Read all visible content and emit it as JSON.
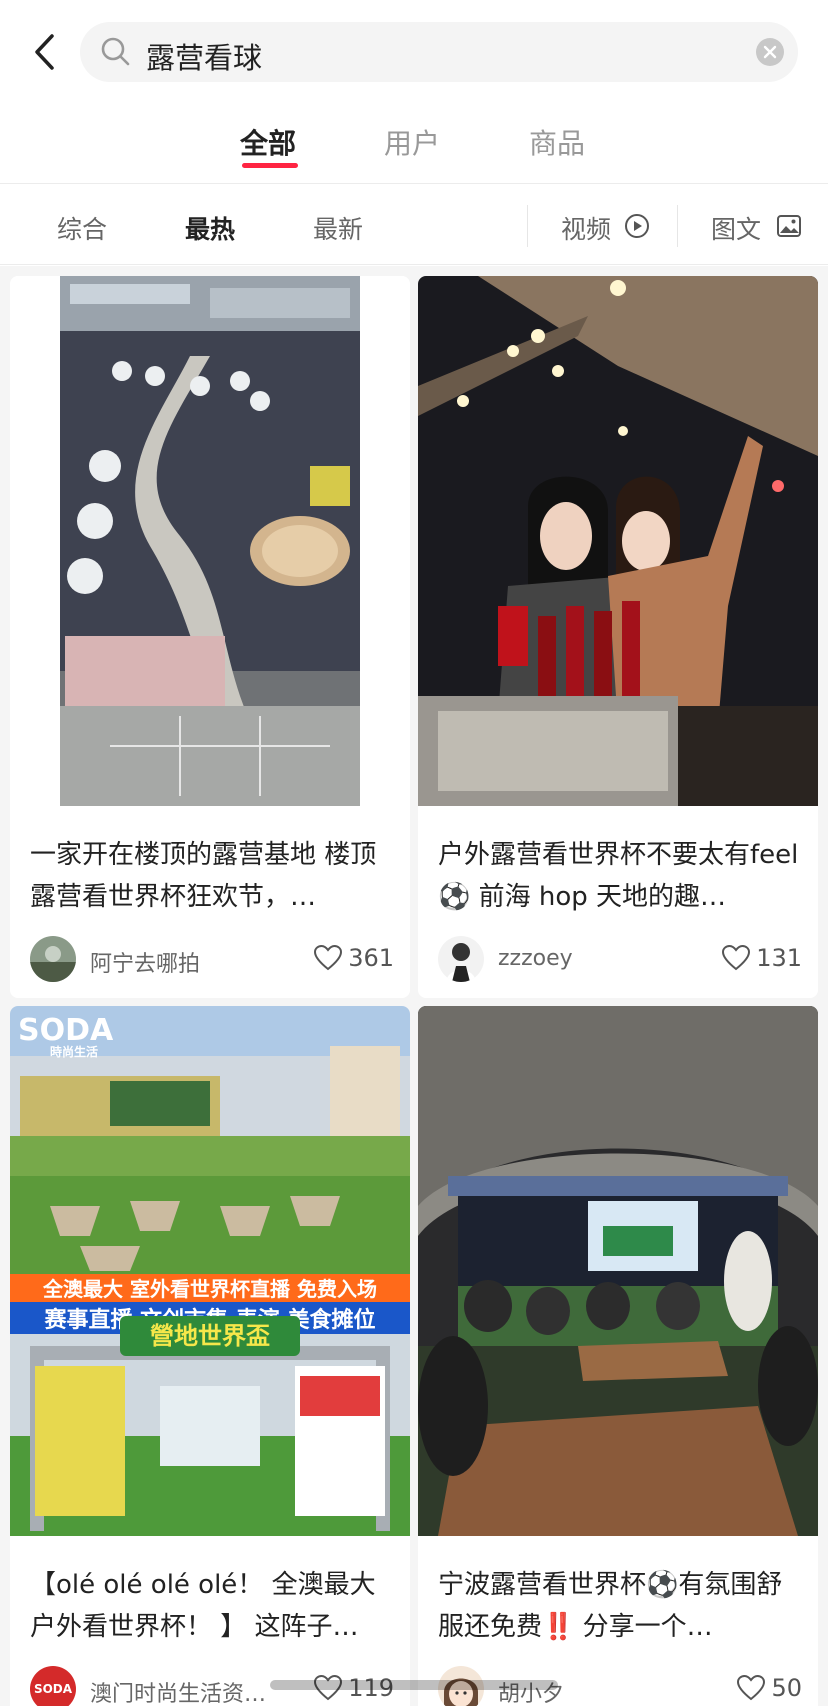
{
  "search": {
    "query": "露营看球"
  },
  "tabs": [
    {
      "label": "全部",
      "active": true
    },
    {
      "label": "用户",
      "active": false
    },
    {
      "label": "商品",
      "active": false
    }
  ],
  "filters": {
    "sort": [
      {
        "label": "综合",
        "active": false
      },
      {
        "label": "最热",
        "active": true
      },
      {
        "label": "最新",
        "active": false
      }
    ],
    "video_label": "视频",
    "image_text_label": "图文"
  },
  "cards": [
    {
      "title": "一家开在楼顶的露营基地 楼顶露营看世界杯狂欢节，…",
      "author": "阿宁去哪拍",
      "likes": "361"
    },
    {
      "title": "户外露营看世界杯不要太有feel⚽ 前海 hop 天地的趣…",
      "author": "zzzoey",
      "likes": "131"
    },
    {
      "title": "【olé olé olé olé！ 全澳最大户外看世界杯！ 】 这阵子…",
      "author": "澳门时尚生活资…",
      "likes": "119",
      "image_text": {
        "logo": "SODA",
        "logo_sub": "時尚生活",
        "banner1": "全澳最大 室外看世界杯直播 免费入场",
        "banner2": "赛事直播 文创市集 表演 美食摊位",
        "stage_sign": "營地世界盃",
        "avatar_text": "SODA"
      }
    },
    {
      "title": "宁波露营看世界杯⚽有氛围舒服还免费‼️ 分享一个…",
      "author": "胡小夕",
      "likes": "50"
    }
  ],
  "colors": {
    "accent": "#ff2442",
    "banner_orange": "#ff6a1a",
    "banner_blue": "#1a57c9"
  }
}
